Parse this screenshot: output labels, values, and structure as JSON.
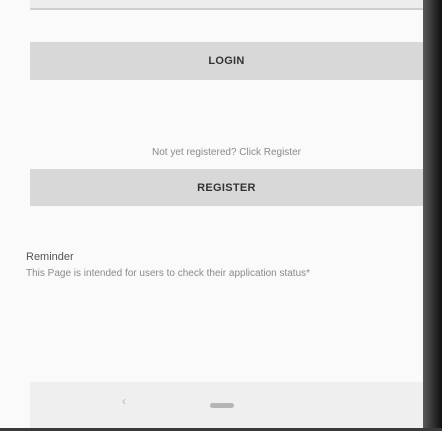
{
  "auth": {
    "login_label": "LOGIN",
    "register_hint": "Not yet registered? Click Register",
    "register_label": "REGISTER"
  },
  "reminder": {
    "title": "Reminder",
    "text": "This Page is intended for users to check their application status*"
  },
  "navbar": {
    "back_glyph": "‹",
    "back_icon": "back-chevron",
    "home_icon": "home-pill"
  }
}
